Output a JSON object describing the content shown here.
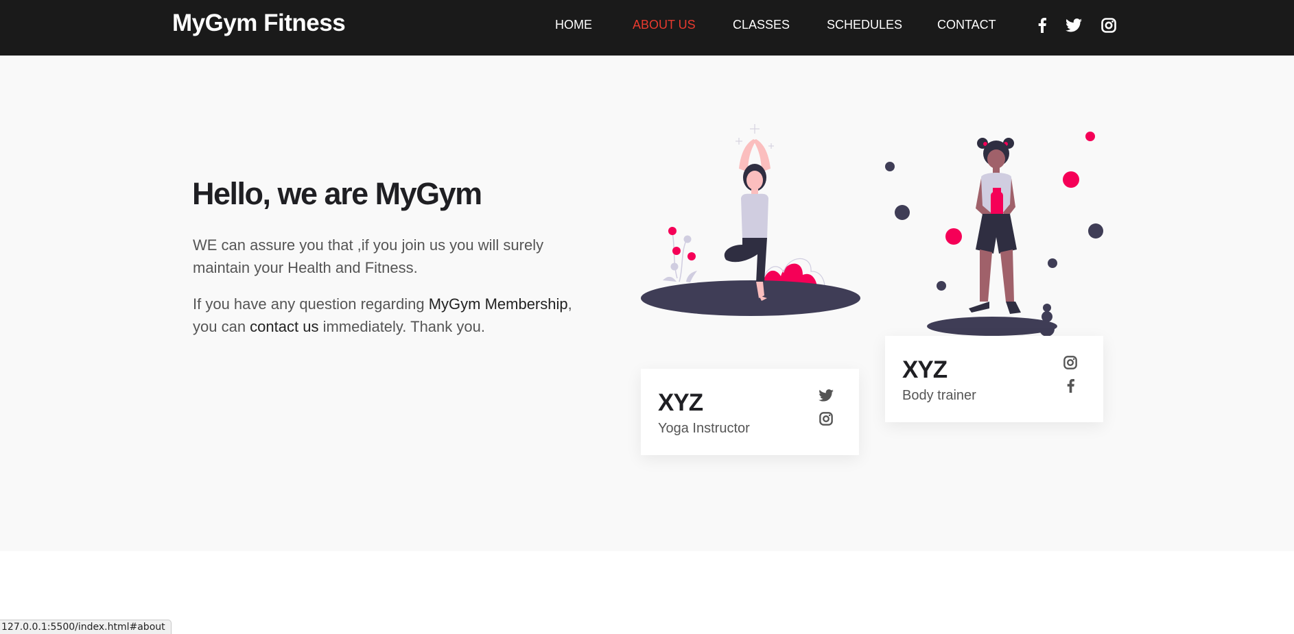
{
  "header": {
    "brand": "MyGym Fitness",
    "nav": [
      {
        "label": "HOME"
      },
      {
        "label": "ABOUT US",
        "active": true
      },
      {
        "label": "CLASSES"
      },
      {
        "label": "SCHEDULES"
      },
      {
        "label": "CONTACT"
      }
    ],
    "social_icons": [
      "facebook-icon",
      "twitter-icon",
      "instagram-icon"
    ]
  },
  "about": {
    "heading": "Hello, we are MyGym",
    "para1": "WE can assure you that ,if you join us you will surely maintain your Health and Fitness.",
    "para2_start": "If you have any question regarding ",
    "para2_strong": "MyGym Membership",
    "para2_mid": ", you can ",
    "para2_link": "contact us",
    "para2_end": " immediately. Thank you."
  },
  "trainers": [
    {
      "name": "XYZ",
      "role": "Yoga Instructor",
      "icons": [
        "twitter-icon",
        "instagram-icon"
      ]
    },
    {
      "name": "XYZ",
      "role": "Body trainer",
      "icons": [
        "instagram-icon",
        "facebook-icon"
      ]
    }
  ],
  "status_url": "127.0.0.1:5500/index.html#about",
  "colors": {
    "header_bg": "#1a1a1a",
    "active_link": "#e83a2e",
    "section_bg": "#f9f9f9",
    "accent_pink": "#f50057",
    "dark_figure": "#3f3d56"
  }
}
